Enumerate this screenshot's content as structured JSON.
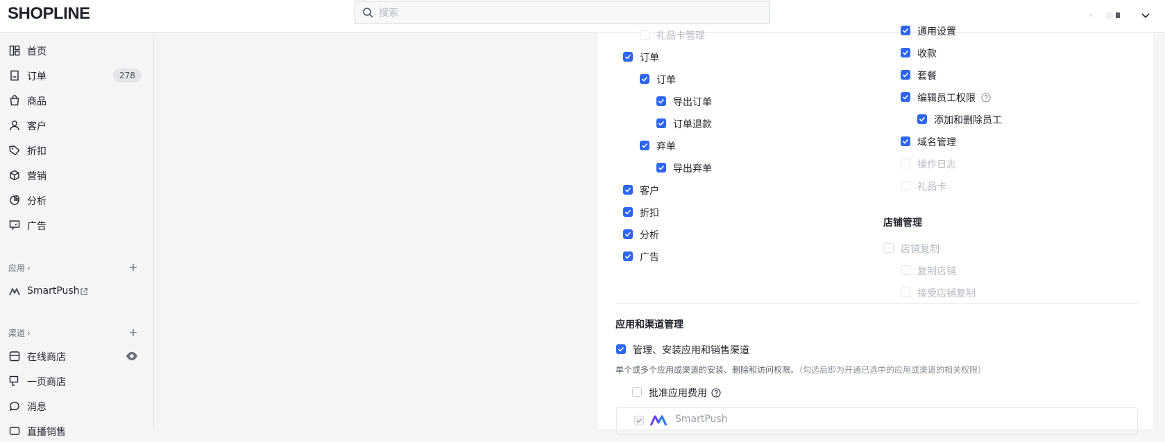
{
  "header": {
    "logo": "SHOPLINE",
    "search_placeholder": "搜索"
  },
  "sidebar": {
    "nav": [
      {
        "label": "首页",
        "icon": "home-icon"
      },
      {
        "label": "订单",
        "icon": "order-icon",
        "badge": "278"
      },
      {
        "label": "商品",
        "icon": "bag-icon"
      },
      {
        "label": "客户",
        "icon": "customer-icon"
      },
      {
        "label": "折扣",
        "icon": "tag-icon"
      },
      {
        "label": "营销",
        "icon": "cube-icon"
      },
      {
        "label": "分析",
        "icon": "chart-icon"
      },
      {
        "label": "广告",
        "icon": "ad-icon"
      }
    ],
    "apps_heading": "应用",
    "apps": [
      {
        "label": "SmartPush"
      }
    ],
    "channels_heading": "渠道",
    "channels": [
      {
        "label": "在线商店"
      },
      {
        "label": "一页商店"
      },
      {
        "label": "消息"
      },
      {
        "label": "直播销售"
      }
    ]
  },
  "permissions": {
    "left": [
      {
        "label": "礼品卡管理",
        "state": "disabled"
      },
      {
        "label": "订单",
        "state": "checked"
      },
      {
        "label": "订单",
        "state": "checked"
      },
      {
        "label": "导出订单",
        "state": "checked"
      },
      {
        "label": "订单退款",
        "state": "checked"
      },
      {
        "label": "弃单",
        "state": "checked"
      },
      {
        "label": "导出弃单",
        "state": "checked"
      },
      {
        "label": "客户",
        "state": "checked"
      },
      {
        "label": "折扣",
        "state": "checked"
      },
      {
        "label": "分析",
        "state": "checked"
      },
      {
        "label": "广告",
        "state": "checked"
      }
    ],
    "right": [
      {
        "label": "通用设置",
        "state": "checked"
      },
      {
        "label": "收款",
        "state": "checked"
      },
      {
        "label": "套餐",
        "state": "checked"
      },
      {
        "label": "编辑员工权限",
        "state": "checked"
      },
      {
        "label": "添加和删除员工",
        "state": "checked"
      },
      {
        "label": "域名管理",
        "state": "checked"
      },
      {
        "label": "操作日志",
        "state": "disabled"
      },
      {
        "label": "礼品卡",
        "state": "disabled"
      }
    ],
    "store_mgmt_title": "店铺管理",
    "store_mgmt": [
      {
        "label": "店铺复制",
        "state": "disabled"
      },
      {
        "label": "复制店铺",
        "state": "disabled"
      },
      {
        "label": "接受店铺复制",
        "state": "disabled"
      }
    ]
  },
  "app_channel": {
    "title": "应用和渠道管理",
    "manage_label": "管理、安装应用和销售渠道",
    "manage_state": "checked",
    "description": "单个或多个应用或渠道的安装、删除和访问权限。",
    "description_note": "（勾选后即为开通已选中的应用或渠道的相关权限）",
    "approve_fee_label": "批准应用费用",
    "approve_fee_state": "unchecked",
    "app_name": "SmartPush",
    "app_state": "disabled-checked"
  },
  "colors": {
    "accent": "#2f66f0",
    "disabled_text": "#b4b9c1"
  }
}
